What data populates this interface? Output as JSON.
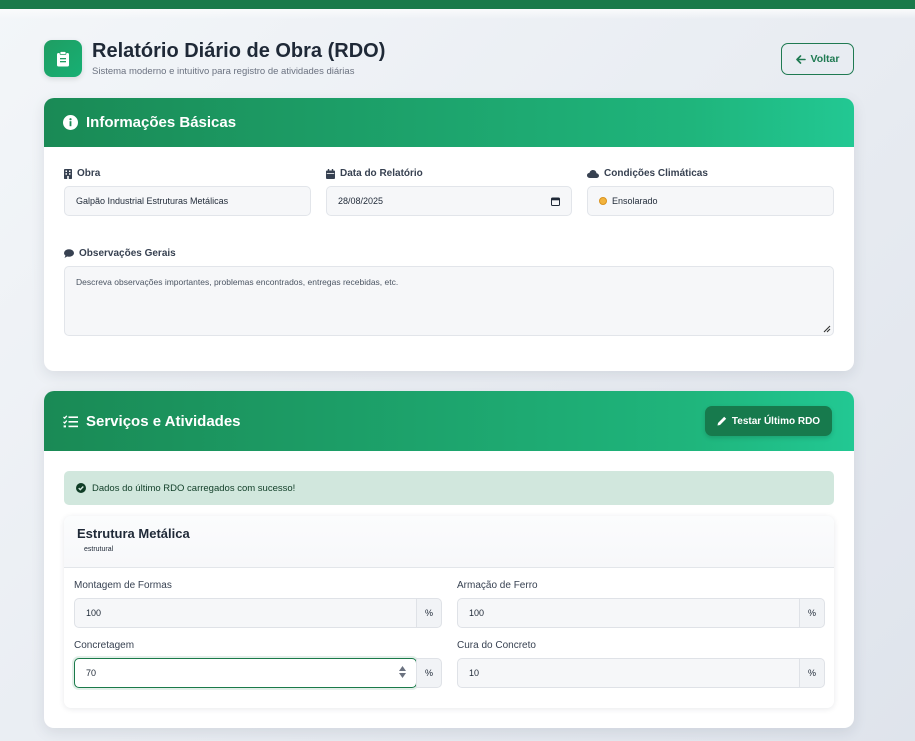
{
  "header": {
    "title": "Relatório Diário de Obra (RDO)",
    "subtitle": "Sistema moderno e intuitivo para registro de atividades diárias",
    "icon": "clipboard-icon",
    "back_label": "Voltar"
  },
  "basic_info": {
    "title": "Informações Básicas",
    "obra": {
      "label": "Obra",
      "value": "Galpão Industrial Estruturas Metálicas"
    },
    "date": {
      "label": "Data do Relatório",
      "value": "28/08/2025"
    },
    "weather": {
      "label": "Condições Climáticas",
      "value": "Ensolarado"
    },
    "notes": {
      "label": "Observações Gerais",
      "placeholder": "Descreva observações importantes, problemas encontrados, entregas recebidas, etc."
    }
  },
  "services": {
    "title": "Serviços e Atividades",
    "test_button": "Testar Último RDO",
    "alert": "Dados do último RDO carregados com sucesso!",
    "service": {
      "name": "Estrutura Metálica",
      "category": "estrutural",
      "items": [
        {
          "label": "Montagem de Formas",
          "value": "100",
          "unit": "%"
        },
        {
          "label": "Armação de Ferro",
          "value": "100",
          "unit": "%"
        },
        {
          "label": "Concretagem",
          "value": "70",
          "unit": "%"
        },
        {
          "label": "Cura do Concreto",
          "value": "10",
          "unit": "%"
        }
      ]
    }
  },
  "colors": {
    "primary": "#1a8a55",
    "accent": "#22c893",
    "alert_bg": "#d1e7dd"
  }
}
